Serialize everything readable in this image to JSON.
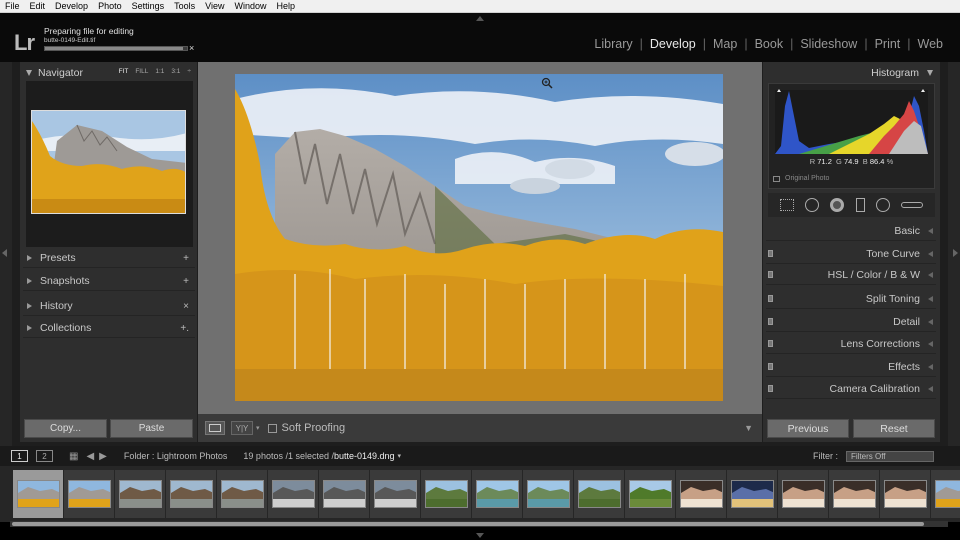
{
  "menu": [
    "File",
    "Edit",
    "Develop",
    "Photo",
    "Settings",
    "Tools",
    "View",
    "Window",
    "Help"
  ],
  "logo": "Lr",
  "progress": {
    "title": "Preparing file for editing",
    "file": "butte-0149-Edit.tif",
    "fraction": 0.97,
    "close": "×"
  },
  "modules": [
    {
      "label": "Library",
      "active": false
    },
    {
      "label": "Develop",
      "active": true
    },
    {
      "label": "Map",
      "active": false
    },
    {
      "label": "Book",
      "active": false
    },
    {
      "label": "Slideshow",
      "active": false
    },
    {
      "label": "Print",
      "active": false
    },
    {
      "label": "Web",
      "active": false
    }
  ],
  "navigator": {
    "title": "Navigator",
    "zoom": [
      "FIT",
      "FILL",
      "1:1",
      "3:1"
    ],
    "zoom_more": "÷"
  },
  "left_sections": [
    {
      "label": "Presets",
      "action": "+"
    },
    {
      "label": "Snapshots",
      "action": "+"
    },
    {
      "label": "History",
      "action": "×"
    },
    {
      "label": "Collections",
      "action": "+."
    }
  ],
  "left_buttons": {
    "copy": "Copy...",
    "paste": "Paste"
  },
  "toolbar": {
    "soft_proofing": "Soft Proofing",
    "yy": "Y|Y"
  },
  "histogram": {
    "title": "Histogram",
    "r_label": "R",
    "r": "71.2",
    "g_label": "G",
    "g": "74.9",
    "b_label": "B",
    "b": "86.4",
    "unit": "%",
    "original": "Original Photo"
  },
  "right_sections": [
    {
      "label": "Basic",
      "switch": false
    },
    {
      "label": "Tone Curve",
      "switch": true
    },
    {
      "label": "HSL  /  Color  /  B & W",
      "switch": true
    },
    {
      "label": "Split Toning",
      "switch": true
    },
    {
      "label": "Detail",
      "switch": true
    },
    {
      "label": "Lens Corrections",
      "switch": true
    },
    {
      "label": "Effects",
      "switch": true
    },
    {
      "label": "Camera Calibration",
      "switch": true
    }
  ],
  "right_buttons": {
    "previous": "Previous",
    "reset": "Reset"
  },
  "filmstrip_bar": {
    "page1": "1",
    "page2": "2",
    "source": "Folder : Lightroom Photos",
    "count": "19 photos /1 selected /",
    "file": "butte-0149.dng",
    "filter_label": "Filter :",
    "filter_value": "Filters Off"
  },
  "thumbnails": [
    "aspen",
    "aspen",
    "bridge",
    "bridge",
    "bridge",
    "village",
    "village",
    "village",
    "valley",
    "lake",
    "lake",
    "valley",
    "field",
    "portrait",
    "city",
    "portrait",
    "portrait",
    "portrait",
    "aspen"
  ],
  "colors": {
    "accent": "#e8e8e8",
    "panel": "#2e2e2e",
    "canvas": "#707070"
  }
}
